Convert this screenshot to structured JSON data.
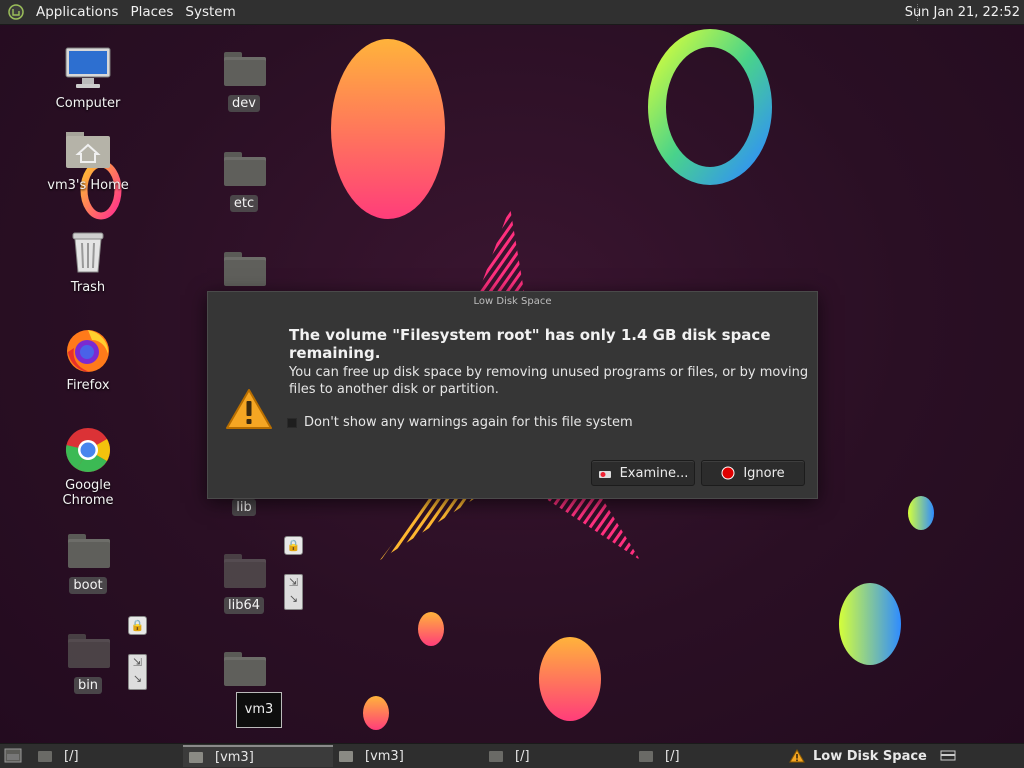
{
  "top_panel": {
    "menus": [
      "Applications",
      "Places",
      "System"
    ],
    "clock": "Sun Jan 21, 22:52"
  },
  "desktop": {
    "left_column": [
      "Computer",
      "vm3's Home",
      "Trash",
      "Firefox",
      "Google Chrome",
      "boot",
      "bin"
    ],
    "second_column": [
      "dev",
      "etc",
      "lib",
      "lib64"
    ]
  },
  "tooltip": "vm3",
  "dialog": {
    "title": "Low Disk Space",
    "heading": "The volume \"Filesystem root\" has only 1.4 GB disk space remaining.",
    "body": "You can free up disk space by removing unused programs or files, or by moving files to another disk or partition.",
    "checkbox_label": "Don't show any warnings again for this file system",
    "examine_label": "Examine...",
    "ignore_label": "Ignore"
  },
  "taskbar": {
    "tasks": [
      "[/]",
      "[vm3]",
      "[vm3]",
      "[/]",
      "[/]",
      "Low Disk Space"
    ]
  },
  "colors": {
    "panel": "#303030",
    "dialog_bg": "#363636",
    "wallpaper": "#2a0f24",
    "warning_orange": "#f5a623",
    "ignore_red": "#e00000"
  }
}
